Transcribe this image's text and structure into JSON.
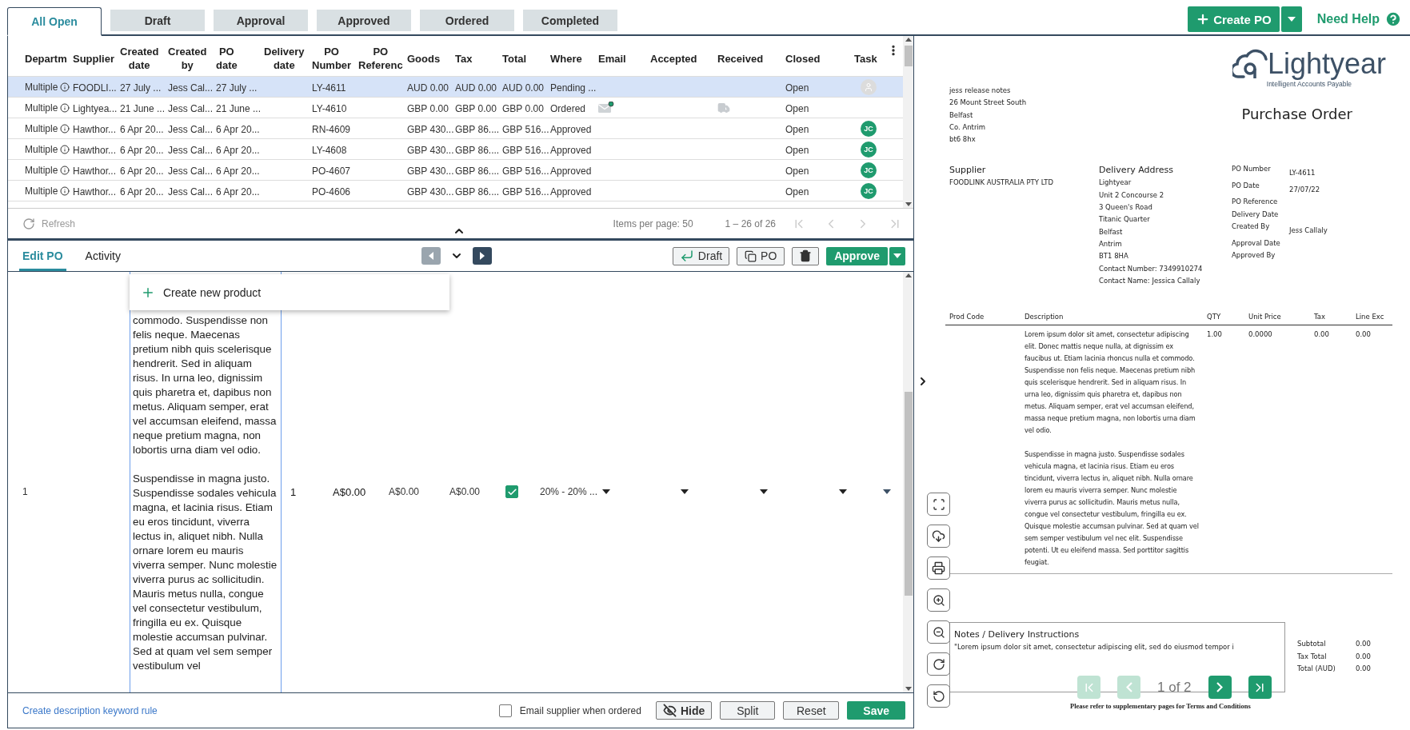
{
  "status_tabs": [
    {
      "label": "All Open",
      "selected": true
    },
    {
      "label": "Draft",
      "selected": false
    },
    {
      "label": "Approval",
      "selected": false
    },
    {
      "label": "Approved",
      "selected": false
    },
    {
      "label": "Ordered",
      "selected": false
    },
    {
      "label": "Completed",
      "selected": false
    }
  ],
  "create_po": {
    "label": "Create PO"
  },
  "help": {
    "label": "Need Help"
  },
  "table": {
    "columns": [
      "Departm",
      "Supplier",
      "Created date",
      "Created by",
      "PO date",
      "Delivery date",
      "PO Number",
      "PO Referenc",
      "Goods",
      "Tax",
      "Total",
      "Where",
      "Email",
      "Accepted",
      "Received",
      "Closed",
      "Task"
    ],
    "rows": [
      {
        "selected": true,
        "department": "Multiple",
        "supplier": "FOODLI...",
        "created_date": "27 July ...",
        "created_by": "Jess Cal...",
        "po_date": "27 July ...",
        "po_number": "LY-4611",
        "goods": "AUD 0.00",
        "tax": "AUD 0.00",
        "total": "AUD 0.00",
        "where": "Pending ...",
        "emailed": false,
        "received": false,
        "closed": "Open",
        "task": {
          "kind": "unassigned"
        }
      },
      {
        "selected": false,
        "department": "Multiple",
        "supplier": "Lightyea...",
        "created_date": "21 June ...",
        "created_by": "Jess Cal...",
        "po_date": "21 June ...",
        "po_number": "LY-4610",
        "goods": "GBP 0.00",
        "tax": "GBP 0.00",
        "total": "GBP 0.00",
        "where": "Ordered",
        "emailed": true,
        "received": true,
        "closed": "Open"
      },
      {
        "selected": false,
        "department": "Multiple",
        "supplier": "Hawthor...",
        "created_date": "6 Apr 20...",
        "created_by": "Jess Cal...",
        "po_date": "6 Apr 20...",
        "po_number": "RN-4609",
        "goods": "GBP 430...",
        "tax": "GBP 86....",
        "total": "GBP 516...",
        "where": "Approved",
        "emailed": false,
        "received": false,
        "closed": "Open",
        "task": {
          "kind": "initials",
          "text": "JC"
        }
      },
      {
        "selected": false,
        "department": "Multiple",
        "supplier": "Hawthor...",
        "created_date": "6 Apr 20...",
        "created_by": "Jess Cal...",
        "po_date": "6 Apr 20...",
        "po_number": "LY-4608",
        "goods": "GBP 430...",
        "tax": "GBP 86....",
        "total": "GBP 516...",
        "where": "Approved",
        "emailed": false,
        "received": false,
        "closed": "Open",
        "task": {
          "kind": "initials",
          "text": "JC"
        }
      },
      {
        "selected": false,
        "department": "Multiple",
        "supplier": "Hawthor...",
        "created_date": "6 Apr 20...",
        "created_by": "Jess Cal...",
        "po_date": "6 Apr 20...",
        "po_number": "PO-4607",
        "goods": "GBP 430...",
        "tax": "GBP 86....",
        "total": "GBP 516...",
        "where": "Approved",
        "emailed": false,
        "received": false,
        "closed": "Open",
        "task": {
          "kind": "initials",
          "text": "JC"
        }
      },
      {
        "selected": false,
        "department": "Multiple",
        "supplier": "Hawthor...",
        "created_date": "6 Apr 20...",
        "created_by": "Jess Cal...",
        "po_date": "6 Apr 20...",
        "po_number": "PO-4606",
        "goods": "GBP 430...",
        "tax": "GBP 86....",
        "total": "GBP 516...",
        "where": "Approved",
        "emailed": false,
        "received": false,
        "closed": "Open",
        "task": {
          "kind": "initials",
          "text": "JC"
        }
      }
    ],
    "footer": {
      "refresh": "Refresh",
      "items_per_page": "Items per page: 50",
      "range": "1 – 26 of 26",
      "can_go_back": false,
      "can_go_forward": false
    }
  },
  "editor": {
    "tabs": [
      {
        "label": "Edit PO",
        "selected": true
      },
      {
        "label": "Activity",
        "selected": false
      }
    ],
    "can_go_previous": false,
    "can_go_next": true,
    "actions": {
      "draft": "Draft",
      "copy": "PO",
      "approve": "Approve"
    },
    "popup": {
      "label": "Create new product"
    },
    "line": {
      "number": "1",
      "description": "commodo. Suspendisse non felis neque. Maecenas pretium nibh quis scelerisque hendrerit. Sed in aliquam risus. In urna leo, dignissim quis pharetra et, dapibus non metus. Aliquam semper, erat vel accumsan eleifend, massa neque pretium magna, non lobortis urna diam vel odio.\n\nSuspendisse in magna justo. Suspendisse sodales vehicula magna, et lacinia risus. Etiam eu eros tincidunt, viverra lectus in, aliquet nibh. Nulla ornare lorem eu mauris viverra semper. Nunc molestie viverra purus ac sollicitudin. Mauris metus nulla, congue vel consectetur vestibulum, fringilla eu ex. Quisque molestie accumsan pulvinar. Sed at quam vel sem semper vestibulum vel",
      "qty": "1",
      "price": "A$0.00",
      "column_a": "A$0.00",
      "column_b": "A$0.00",
      "checked": true,
      "tax_rate": "20% - 20% ..."
    },
    "keyword_rule": "Create description keyword rule",
    "email_supplier": {
      "label": "Email supplier when ordered",
      "checked": false
    },
    "buttons": {
      "hide": "Hide",
      "split": "Split",
      "reset": "Reset",
      "save": "Save"
    }
  },
  "document": {
    "sender_lines": [
      "jess release notes",
      "26 Mount Street South",
      "Belfast",
      "Co. Antrim",
      "bt6 8hx"
    ],
    "logo": {
      "name": "Lightyear",
      "tagline": "Intelligent Accounts Payable"
    },
    "title": "Purchase Order",
    "supplier": {
      "heading": "Supplier",
      "lines": [
        "FOODLINK AUSTRALIA PTY LTD"
      ]
    },
    "delivery": {
      "heading": "Delivery Address",
      "lines": [
        "Lightyear",
        "Unit 2 Concourse 2",
        "3 Queen's Road",
        "Titanic Quarter",
        "Belfast",
        "Antrim",
        "BT1 8HA",
        "Contact Number: 7349910274",
        "Contact Name: Jessica Callaly"
      ]
    },
    "details": [
      {
        "label": "PO Number",
        "value": "LY-4611"
      },
      {
        "label": "PO Date",
        "value": "27/07/22"
      },
      {
        "label": "PO Reference"
      },
      {
        "label": "Delivery Date"
      },
      {
        "label": "Created By",
        "value": "Jess Callaly"
      },
      {
        "label": "Approval Date"
      },
      {
        "label": "Approved By"
      }
    ],
    "line_columns": [
      "Prod Code",
      "Description",
      "QTY",
      "Unit Price",
      "Tax",
      "Line Exc"
    ],
    "lines": [
      {
        "description": [
          "Lorem ipsum dolor sit amet, consectetur adipiscing elit. Donec mattis neque nulla, at dignissim ex faucibus ut. Etiam lacinia rhoncus nulla et commodo. Suspendisse non felis neque. Maecenas pretium nibh quis scelerisque hendrerit. Sed in aliquam risus. In urna leo, dignissim quis pharetra et, dapibus non metus. Aliquam semper, erat vel accumsan eleifend, massa neque pretium magna, non lobortis urna diam vel odio.",
          "Suspendisse in magna justo. Suspendisse sodales vehicula magna, et lacinia risus. Etiam eu eros tincidunt, viverra lectus in, aliquet nibh. Nulla ornare lorem eu mauris viverra semper. Nunc molestie viverra purus ac sollicitudin. Mauris metus nulla, congue vel consectetur vestibulum, fringilla eu ex. Quisque molestie accumsan pulvinar. Sed at quam vel sem semper vestibulum vel nec elit. Suspendisse potenti. Ut eu eleifend massa. Sed porttitor sagittis feugiat."
        ],
        "qty": "1.00",
        "unit_price": "0.0000",
        "tax": "0.00",
        "line_exc": "0.00"
      }
    ],
    "notes": {
      "heading": "Notes / Delivery Instructions",
      "text": "\"Lorem ipsum dolor sit amet, consectetur adipiscing elit, sed do eiusmod tempor i"
    },
    "totals": [
      {
        "label": "Subtotal",
        "value": "0.00"
      },
      {
        "label": "Tax Total",
        "value": "0.00"
      },
      {
        "label": "Total (AUD)",
        "value": "0.00"
      }
    ],
    "footer_note": "Please refer to supplementary pages for Terms and Conditions",
    "pager": {
      "label": "1 of 2",
      "can_go_back": false,
      "can_go_forward": true
    }
  }
}
